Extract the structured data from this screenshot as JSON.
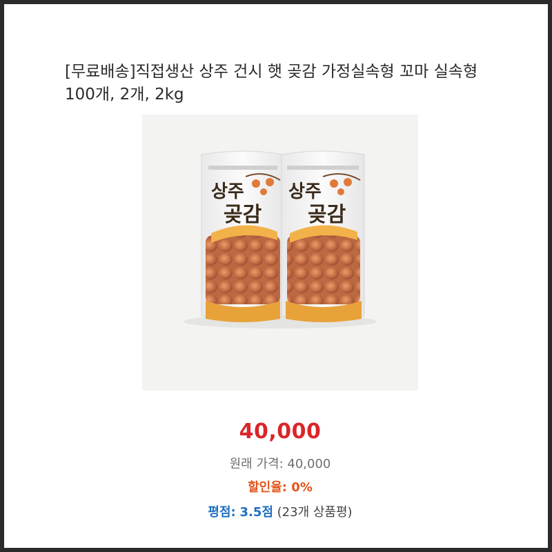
{
  "product": {
    "title": "[무료배송]직접생산 상주 건시 햇 곶감 가정실속형 꼬마 실속형 100개, 2개, 2kg",
    "image": {
      "bag_label_top": "상주",
      "bag_label_bottom": "곶감"
    },
    "price": "40,000",
    "original_price_label": "원래 가격:",
    "original_price": "40,000",
    "discount_label": "할인율:",
    "discount": "0%",
    "rating_label": "평점:",
    "rating_value": "3.5점",
    "review_count": "(23개 상품평)"
  },
  "colors": {
    "price": "#d9262a",
    "discount": "#e2541b",
    "rating": "#1f6fbf"
  }
}
